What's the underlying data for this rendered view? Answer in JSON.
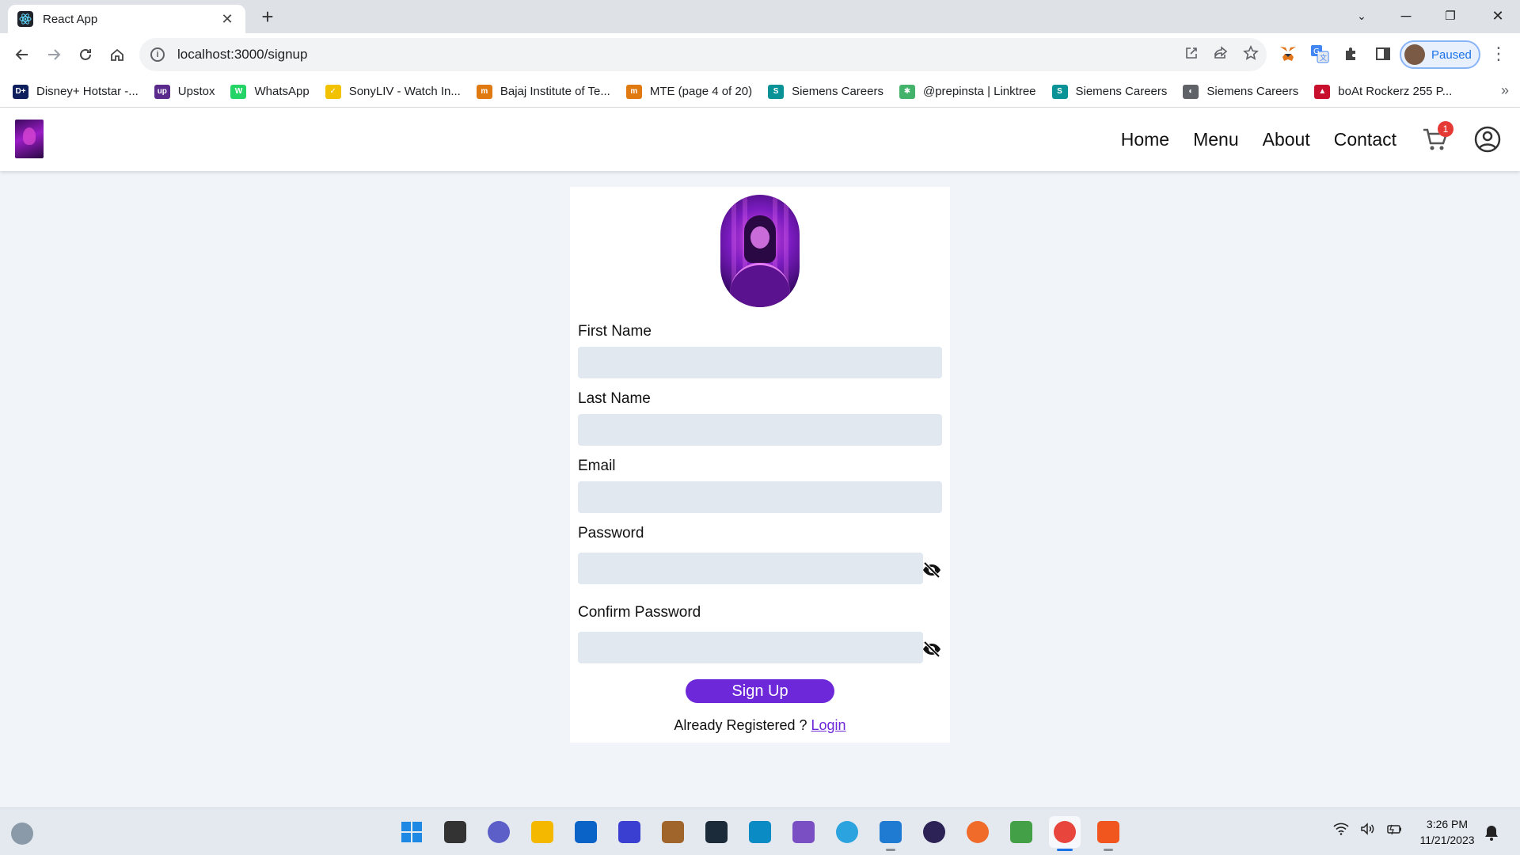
{
  "browser": {
    "tab_title": "React App",
    "url": "localhost:3000/signup",
    "profile_status": "Paused",
    "bookmarks": [
      {
        "label": "Disney+ Hotstar -...",
        "icon": "hotstar-icon",
        "color": "#0f1e5c",
        "glyph": "D+"
      },
      {
        "label": "Upstox",
        "icon": "upstox-icon",
        "color": "#5a2a8c",
        "glyph": "up"
      },
      {
        "label": "WhatsApp",
        "icon": "whatsapp-icon",
        "color": "#25d366",
        "glyph": "W"
      },
      {
        "label": "SonyLIV - Watch In...",
        "icon": "sonyliv-icon",
        "color": "#f2c200",
        "glyph": "✓"
      },
      {
        "label": "Bajaj Institute of Te...",
        "icon": "bajaj-icon",
        "color": "#e07a10",
        "glyph": "m"
      },
      {
        "label": "MTE (page 4 of 20)",
        "icon": "mte-icon",
        "color": "#e07a10",
        "glyph": "m"
      },
      {
        "label": "Siemens Careers",
        "icon": "siemens-icon",
        "color": "#0a9396",
        "glyph": "S"
      },
      {
        "label": "@prepinsta | Linktree",
        "icon": "linktree-icon",
        "color": "#43b36b",
        "glyph": "✱"
      },
      {
        "label": "Siemens Careers",
        "icon": "siemens-icon",
        "color": "#0a9396",
        "glyph": "S"
      },
      {
        "label": "Siemens Careers",
        "icon": "globe-icon",
        "color": "#5f6368",
        "glyph": "◐"
      },
      {
        "label": "boAt Rockerz 255 P...",
        "icon": "boat-icon",
        "color": "#c8102e",
        "glyph": "▲"
      }
    ]
  },
  "app": {
    "nav": {
      "home": "Home",
      "menu": "Menu",
      "about": "About",
      "contact": "Contact",
      "cart_count": "1"
    },
    "form": {
      "first_name_label": "First Name",
      "last_name_label": "Last Name",
      "email_label": "Email",
      "password_label": "Password",
      "confirm_password_label": "Confirm Password",
      "first_name_value": "",
      "last_name_value": "",
      "email_value": "",
      "password_value": "",
      "confirm_password_value": "",
      "submit_label": "Sign Up",
      "already_text": "Already Registered ? ",
      "login_link": "Login"
    },
    "colors": {
      "accent": "#6d28d9",
      "input_bg": "#e2e8f0",
      "page_bg": "#f1f5f9",
      "badge": "#e53935"
    }
  },
  "taskbar": {
    "apps": [
      {
        "name": "start-icon",
        "color": "#1e88e5",
        "running": false,
        "active": false
      },
      {
        "name": "task-view-icon",
        "color": "#333",
        "running": false,
        "active": false
      },
      {
        "name": "teams-chat-icon",
        "color": "#5b5fc7",
        "running": false,
        "active": false
      },
      {
        "name": "file-explorer-icon",
        "color": "#f5b800",
        "running": false,
        "active": false
      },
      {
        "name": "mail-icon",
        "color": "#0a64c8",
        "running": false,
        "active": false
      },
      {
        "name": "powerapps-icon",
        "color": "#3a3fd1",
        "running": false,
        "active": false
      },
      {
        "name": "package-icon",
        "color": "#a0652a",
        "running": false,
        "active": false
      },
      {
        "name": "mysql-icon",
        "color": "#1c2b3a",
        "running": false,
        "active": false
      },
      {
        "name": "remote-desktop-icon",
        "color": "#0b8bc4",
        "running": false,
        "active": false
      },
      {
        "name": "visual-studio-icon",
        "color": "#7b4fc4",
        "running": false,
        "active": false
      },
      {
        "name": "telegram-icon",
        "color": "#2aa3de",
        "running": false,
        "active": false
      },
      {
        "name": "vscode-icon",
        "color": "#1f7ad1",
        "running": true,
        "active": false
      },
      {
        "name": "eclipse-icon",
        "color": "#2c2255",
        "running": false,
        "active": false
      },
      {
        "name": "postman-icon",
        "color": "#f06a29",
        "running": false,
        "active": false
      },
      {
        "name": "nodejs-icon",
        "color": "#44a047",
        "running": false,
        "active": false
      },
      {
        "name": "chrome-icon",
        "color": "#e8453c",
        "running": true,
        "active": true
      },
      {
        "name": "brave-icon",
        "color": "#f0561d",
        "running": true,
        "active": false
      }
    ],
    "time": "3:26 PM",
    "date": "11/21/2023"
  }
}
